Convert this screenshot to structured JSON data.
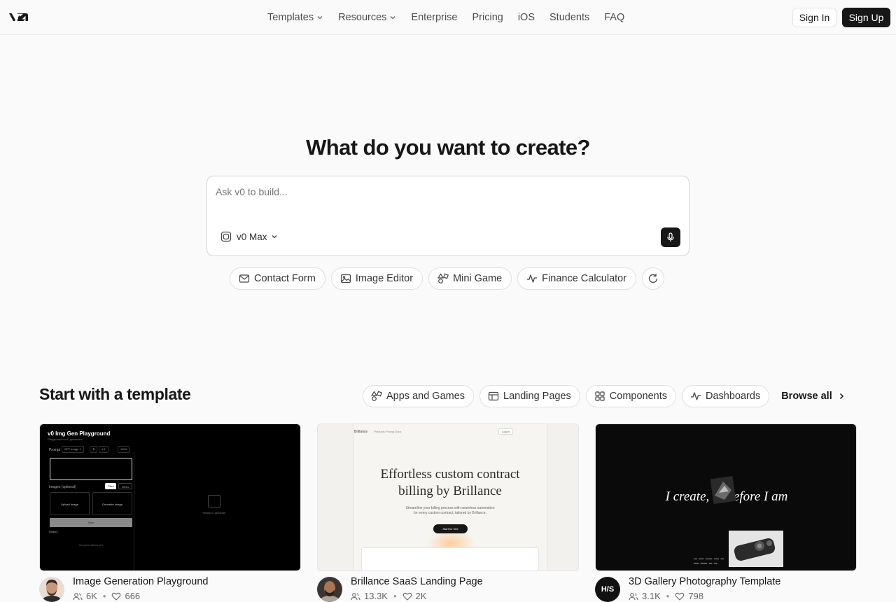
{
  "header": {
    "logo_alt": "v0",
    "nav": [
      {
        "label": "Templates",
        "has_menu": true
      },
      {
        "label": "Resources",
        "has_menu": true
      },
      {
        "label": "Enterprise",
        "has_menu": false
      },
      {
        "label": "Pricing",
        "has_menu": false
      },
      {
        "label": "iOS",
        "has_menu": false
      },
      {
        "label": "Students",
        "has_menu": false
      },
      {
        "label": "FAQ",
        "has_menu": false
      }
    ],
    "sign_in": "Sign In",
    "sign_up": "Sign Up"
  },
  "hero": {
    "title": "What do you want to create?",
    "prompt_placeholder": "Ask v0 to build...",
    "model": "v0 Max",
    "suggestions": [
      {
        "label": "Contact Form",
        "icon": "mail-icon"
      },
      {
        "label": "Image Editor",
        "icon": "image-icon"
      },
      {
        "label": "Mini Game",
        "icon": "shapes-icon"
      },
      {
        "label": "Finance Calculator",
        "icon": "activity-icon"
      }
    ]
  },
  "templates": {
    "title": "Start with a template",
    "filters": [
      {
        "label": "Apps and Games",
        "icon": "shapes-icon"
      },
      {
        "label": "Landing Pages",
        "icon": "layout-icon"
      },
      {
        "label": "Components",
        "icon": "grid-icon"
      },
      {
        "label": "Dashboards",
        "icon": "activity-icon"
      }
    ],
    "browse_all": "Browse all",
    "cards": [
      {
        "title": "Image Generation Playground",
        "users": "6K",
        "likes": "666",
        "preview": {
          "title": "v0 Img Gen Playground",
          "subtitle": "Playground for AI generation",
          "prompt_label": "Prompt",
          "model": "GPT Image 1",
          "ratio": "1:1",
          "count": "1024",
          "images_label": "Images (optional)",
          "tab_files": "Files",
          "tab_urls": "URLs",
          "upload": "Upload Image",
          "generate": "Generate Image",
          "run": "Run",
          "history": "History",
          "empty": "No generations yet",
          "ready": "Ready to generate"
        }
      },
      {
        "title": "Brillance SaaS Landing Page",
        "users": "13.3K",
        "likes": "2K",
        "preview": {
          "brand": "Brillance",
          "links": "Products   Pricing   Docs",
          "login": "Log in",
          "headline_1": "Effortless custom contract",
          "headline_2": "billing by Brillance",
          "sub_1": "Streamline your billing process with seamless automation",
          "sub_2": "for every custom contract, tailored by Brillance.",
          "cta": "Start for free"
        }
      },
      {
        "title": "3D Gallery Photography Template",
        "users": "3.1K",
        "likes": "798",
        "avatar_text": "H/S",
        "preview": {
          "headline": "I create, therefore I am"
        }
      }
    ]
  },
  "colors": {
    "page_bg": "#fafafa",
    "text": "#171717",
    "muted": "#666666",
    "border": "#e0e0e0",
    "button_dark": "#171717"
  }
}
